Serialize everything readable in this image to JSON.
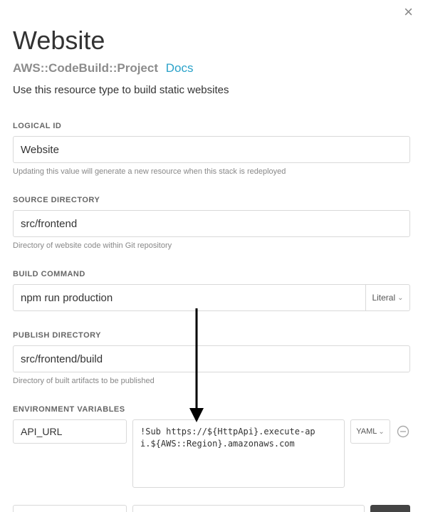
{
  "title": "Website",
  "resourceType": "AWS::CodeBuild::Project",
  "docsLabel": "Docs",
  "description": "Use this resource type to build static websites",
  "fields": {
    "logicalId": {
      "label": "LOGICAL ID",
      "value": "Website",
      "help": "Updating this value will generate a new resource when this stack is redeployed"
    },
    "sourceDirectory": {
      "label": "SOURCE DIRECTORY",
      "value": "src/frontend",
      "help": "Directory of website code within Git repository"
    },
    "buildCommand": {
      "label": "BUILD COMMAND",
      "value": "npm run production",
      "mode": "Literal"
    },
    "publishDirectory": {
      "label": "PUBLISH DIRECTORY",
      "value": "src/frontend/build",
      "help": "Directory of built artifacts to be published"
    },
    "environmentVariables": {
      "label": "ENVIRONMENT VARIABLES",
      "items": [
        {
          "key": "API_URL",
          "value": "!Sub https://${HttpApi}.execute-api.${AWS::Region}.amazonaws.com",
          "mode": "YAML"
        }
      ]
    }
  }
}
